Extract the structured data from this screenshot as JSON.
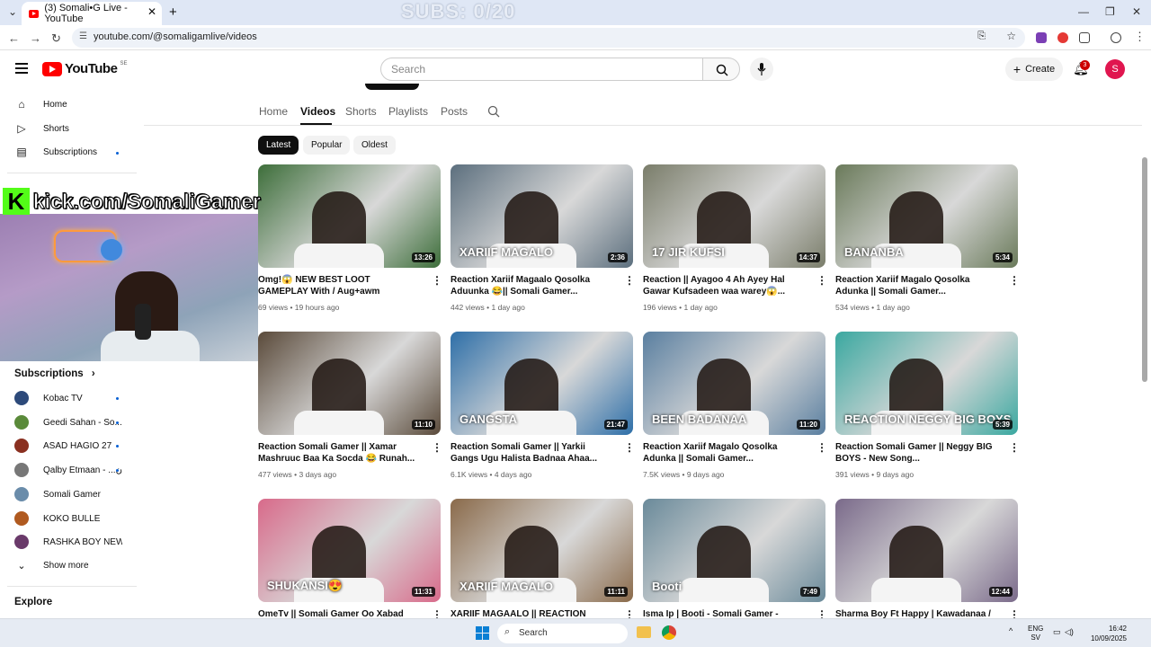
{
  "browser": {
    "tab_title": "(3) Somali•G Live - YouTube",
    "url": "youtube.com/@somaligamlive/videos"
  },
  "overlay": {
    "subs_counter": "SUBS: 0/20",
    "kick_text": "kick.com/SomaliGamer",
    "kick_letter": "K"
  },
  "header": {
    "logo_text": "YouTube",
    "logo_country": "SE",
    "search_placeholder": "Search",
    "create_label": "Create",
    "notification_count": "3",
    "avatar_letter": "S"
  },
  "sidebar": {
    "items": [
      {
        "label": "Home",
        "icon": "home-icon"
      },
      {
        "label": "Shorts",
        "icon": "shorts-icon"
      },
      {
        "label": "Subscriptions",
        "icon": "subscriptions-icon"
      }
    ],
    "subscriptions_heading": "Subscriptions",
    "channels": [
      {
        "name": "Kobac TV",
        "color": "#2d4a7a",
        "new": true
      },
      {
        "name": "Geedi Sahan - So...",
        "color": "#5a8a3a",
        "new": true
      },
      {
        "name": "ASAD HAGIO 27",
        "color": "#8a3020",
        "new": true
      },
      {
        "name": "Qalby Etmaan - ...طمأن",
        "color": "#777777",
        "new": true
      },
      {
        "name": "Somali Gamer",
        "color": "#6a8caa",
        "new": false
      },
      {
        "name": "KOKO BULLE",
        "color": "#b05a20",
        "new": false
      },
      {
        "name": "RASHKA BOY NEW",
        "color": "#6a3a6a",
        "new": false
      }
    ],
    "show_more": "Show more",
    "explore_heading": "Explore"
  },
  "channel_tabs": [
    "Home",
    "Videos",
    "Shorts",
    "Playlists",
    "Posts"
  ],
  "active_tab": "Videos",
  "filter_chips": [
    "Latest",
    "Popular",
    "Oldest"
  ],
  "videos": [
    {
      "title": "Omg!😱 NEW BEST LOOT GAMEPLAY With / Aug+awm @somaligamer",
      "views": "69 views",
      "age": "19 hours ago",
      "duration": "13:26",
      "overlay": "",
      "bg": "#3d6e3a"
    },
    {
      "title": "Reaction Xariif Magaalo Qosolka Aduunka 😂|| Somali Gamer...",
      "views": "442 views",
      "age": "1 day ago",
      "duration": "2:36",
      "overlay": "XARIIF MAGALO",
      "bg": "#5c6f7e"
    },
    {
      "title": "Reaction || Ayagoo 4 Ah Ayey Hal Gawar Kufsadeen waa warey😱...",
      "views": "196 views",
      "age": "1 day ago",
      "duration": "14:37",
      "overlay": "17 JIR KUFSI",
      "bg": "#7a7d6a"
    },
    {
      "title": "Reaction Xariif Magalo Qosolka Adunka || Somali Gamer...",
      "views": "534 views",
      "age": "1 day ago",
      "duration": "5:34",
      "overlay": "BANANBA",
      "bg": "#6a7a5a"
    },
    {
      "title": "Reaction Somali Gamer || Xamar Mashruuc Baa Ka Socda 😂 Runah...",
      "views": "477 views",
      "age": "3 days ago",
      "duration": "11:10",
      "overlay": "",
      "bg": "#5a4a3a"
    },
    {
      "title": "Reaction Somali Gamer || Yarkii Gangs Ugu Halista Badnaa Ahaa...",
      "views": "6.1K views",
      "age": "4 days ago",
      "duration": "21:47",
      "overlay": "GANGSTA",
      "bg": "#2e6fa8"
    },
    {
      "title": "Reaction Xariif Magalo Qosolka Adunka || Somali Gamer...",
      "views": "7.5K views",
      "age": "9 days ago",
      "duration": "11:20",
      "overlay": "BEEN BADANAA",
      "bg": "#5a7fa0"
    },
    {
      "title": "Reaction Somali Gamer || Neggy BIG BOYS - New Song...",
      "views": "391 views",
      "age": "9 days ago",
      "duration": "5:39",
      "overlay": "REACTION NEGGY BIG BOYS",
      "bg": "#3aa8a0"
    },
    {
      "title": "OmeTv || Somali Gamer Oo Xabad Shidan Ka",
      "views": "",
      "age": "",
      "duration": "11:31",
      "overlay": "SHUKANSI😍",
      "bg": "#d86a8a"
    },
    {
      "title": "XARIIF MAGAALO || REACTION SOMALI",
      "views": "",
      "age": "",
      "duration": "11:11",
      "overlay": "XARIIF MAGALO",
      "bg": "#8a6a4a"
    },
    {
      "title": "Isma Ip | Booti - Somali Gamer - Reaction",
      "views": "",
      "age": "",
      "duration": "7:49",
      "overlay": "Booti",
      "bg": "#6a8a9a"
    },
    {
      "title": "Sharma Boy Ft Happy | Kawadanaa /",
      "views": "",
      "age": "",
      "duration": "12:44",
      "overlay": "",
      "bg": "#7a6a8a"
    }
  ],
  "taskbar": {
    "search_placeholder": "Search",
    "lang": "ENG",
    "region": "SV",
    "time": "16:42",
    "date": "10/09/2025"
  }
}
